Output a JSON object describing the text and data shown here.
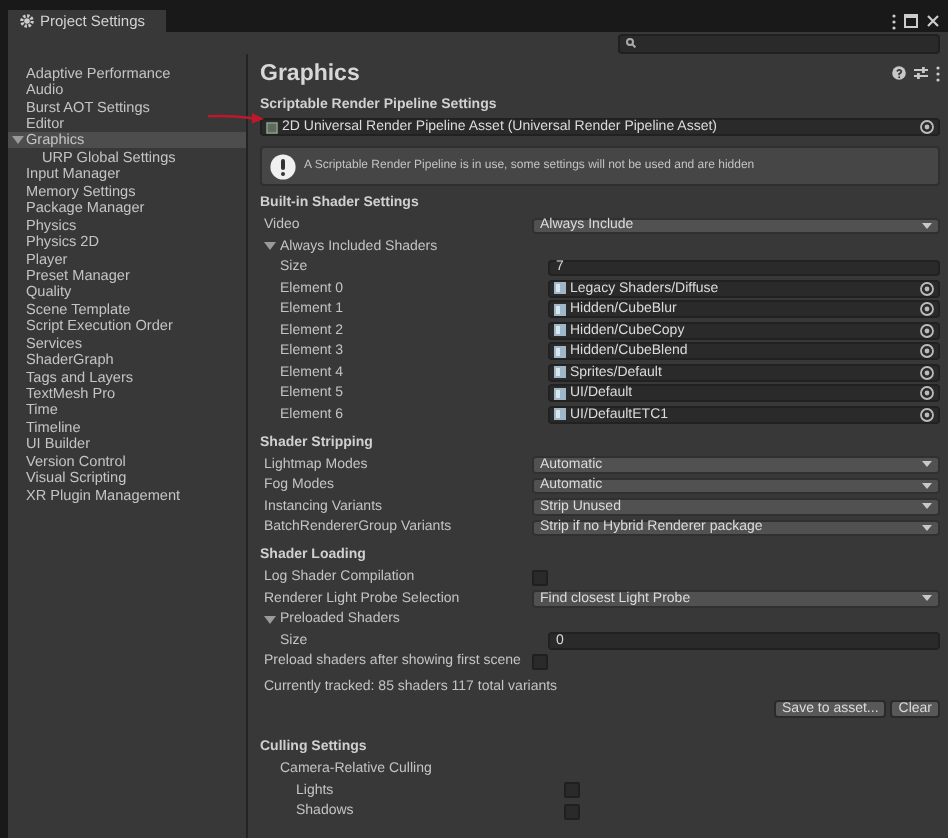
{
  "window": {
    "title": "Project Settings"
  },
  "sidebar": {
    "items": [
      {
        "label": "Adaptive Performance",
        "selected": false
      },
      {
        "label": "Audio",
        "selected": false
      },
      {
        "label": "Burst AOT Settings",
        "selected": false
      },
      {
        "label": "Editor",
        "selected": false
      },
      {
        "label": "Graphics",
        "selected": true,
        "expanded": true,
        "children": [
          {
            "label": "URP Global Settings",
            "selected": false
          }
        ]
      },
      {
        "label": "Input Manager",
        "selected": false
      },
      {
        "label": "Memory Settings",
        "selected": false
      },
      {
        "label": "Package Manager",
        "selected": false
      },
      {
        "label": "Physics",
        "selected": false
      },
      {
        "label": "Physics 2D",
        "selected": false
      },
      {
        "label": "Player",
        "selected": false
      },
      {
        "label": "Preset Manager",
        "selected": false
      },
      {
        "label": "Quality",
        "selected": false
      },
      {
        "label": "Scene Template",
        "selected": false
      },
      {
        "label": "Script Execution Order",
        "selected": false
      },
      {
        "label": "Services",
        "selected": false
      },
      {
        "label": "ShaderGraph",
        "selected": false
      },
      {
        "label": "Tags and Layers",
        "selected": false
      },
      {
        "label": "TextMesh Pro",
        "selected": false
      },
      {
        "label": "Time",
        "selected": false
      },
      {
        "label": "Timeline",
        "selected": false
      },
      {
        "label": "UI Builder",
        "selected": false
      },
      {
        "label": "Version Control",
        "selected": false
      },
      {
        "label": "Visual Scripting",
        "selected": false
      },
      {
        "label": "XR Plugin Management",
        "selected": false
      }
    ]
  },
  "inspector": {
    "title": "Graphics",
    "sections": [
      {
        "header": "Scriptable Render Pipeline Settings",
        "rows": [
          {
            "kind": "asset",
            "value": "2D Universal Render Pipeline Asset (Universal Render Pipeline Asset)"
          },
          {
            "kind": "helpbox",
            "text": "A Scriptable Render Pipeline is in use, some settings will not be used and are hidden"
          }
        ]
      },
      {
        "header": "Built-in Shader Settings",
        "rows": [
          {
            "kind": "dropdown",
            "label": "Video",
            "value": "Always Include"
          },
          {
            "kind": "foldout",
            "label": "Always Included Shaders",
            "expanded": true,
            "children": [
              {
                "kind": "text",
                "label": "Size",
                "value": "7"
              },
              {
                "kind": "object",
                "label": "Element 0",
                "value": "Legacy Shaders/Diffuse"
              },
              {
                "kind": "object",
                "label": "Element 1",
                "value": "Hidden/CubeBlur"
              },
              {
                "kind": "object",
                "label": "Element 2",
                "value": "Hidden/CubeCopy"
              },
              {
                "kind": "object",
                "label": "Element 3",
                "value": "Hidden/CubeBlend"
              },
              {
                "kind": "object",
                "label": "Element 4",
                "value": "Sprites/Default"
              },
              {
                "kind": "object",
                "label": "Element 5",
                "value": "UI/Default"
              },
              {
                "kind": "object",
                "label": "Element 6",
                "value": "UI/DefaultETC1"
              }
            ]
          }
        ]
      },
      {
        "header": "Shader Stripping",
        "rows": [
          {
            "kind": "dropdown",
            "label": "Lightmap Modes",
            "value": "Automatic"
          },
          {
            "kind": "dropdown",
            "label": "Fog Modes",
            "value": "Automatic"
          },
          {
            "kind": "dropdown",
            "label": "Instancing Variants",
            "value": "Strip Unused"
          },
          {
            "kind": "dropdown",
            "label": "BatchRendererGroup Variants",
            "value": "Strip if no Hybrid Renderer package"
          }
        ]
      },
      {
        "header": "Shader Loading",
        "rows": [
          {
            "kind": "checkbox",
            "label": "Log Shader Compilation",
            "checked": false
          },
          {
            "kind": "dropdown",
            "label": "Renderer Light Probe Selection",
            "value": "Find closest Light Probe"
          },
          {
            "kind": "foldout",
            "label": "Preloaded Shaders",
            "expanded": true,
            "children": [
              {
                "kind": "text",
                "label": "Size",
                "value": "0"
              }
            ]
          },
          {
            "kind": "checkbox",
            "label": "Preload shaders after showing first scene",
            "checked": false
          },
          {
            "kind": "info",
            "text": "Currently tracked: 85 shaders 117 total variants"
          },
          {
            "kind": "buttons",
            "buttons": [
              "Save to asset...",
              "Clear"
            ]
          }
        ]
      },
      {
        "header": "Culling Settings",
        "rows": [
          {
            "kind": "group",
            "label": "Camera-Relative Culling",
            "children": [
              {
                "kind": "checkbox",
                "label": "Lights",
                "checked": false
              },
              {
                "kind": "checkbox",
                "label": "Shadows",
                "checked": false
              }
            ]
          }
        ]
      }
    ]
  }
}
